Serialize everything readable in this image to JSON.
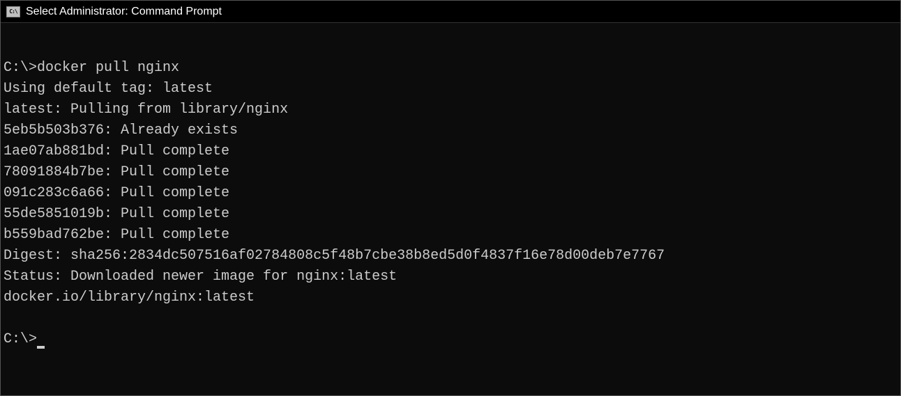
{
  "titlebar": {
    "icon_label": "C:\\",
    "title": "Select Administrator: Command Prompt"
  },
  "terminal": {
    "prompt1": "C:\\>",
    "command1": "docker pull nginx",
    "lines": [
      "Using default tag: latest",
      "latest: Pulling from library/nginx",
      "5eb5b503b376: Already exists",
      "1ae07ab881bd: Pull complete",
      "78091884b7be: Pull complete",
      "091c283c6a66: Pull complete",
      "55de5851019b: Pull complete",
      "b559bad762be: Pull complete",
      "Digest: sha256:2834dc507516af02784808c5f48b7cbe38b8ed5d0f4837f16e78d00deb7e7767",
      "Status: Downloaded newer image for nginx:latest",
      "docker.io/library/nginx:latest"
    ],
    "prompt2": "C:\\>"
  }
}
